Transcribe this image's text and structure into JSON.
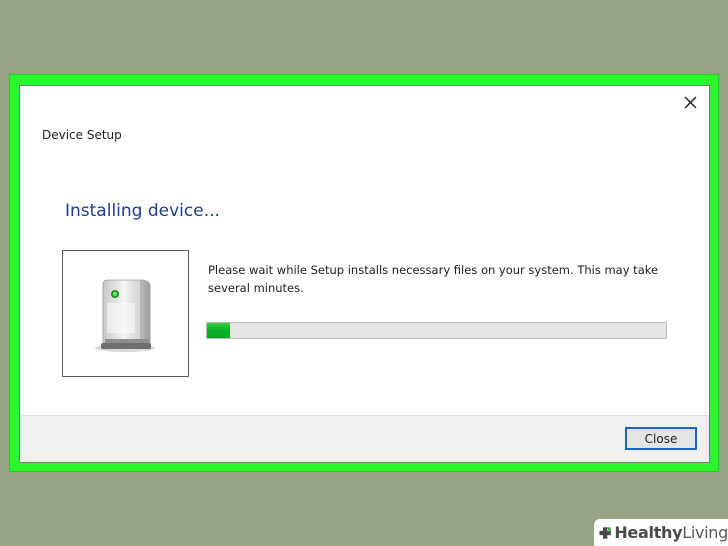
{
  "dialog": {
    "title": "Device Setup",
    "heading": "Installing device...",
    "message": "Please wait while Setup installs necessary files on your system. This may take several minutes.",
    "progress_fraction": 0.05,
    "close_button_label": "Close",
    "close_icon": "close-icon",
    "device_icon": "device-tower-icon"
  },
  "colors": {
    "highlight_frame": "#2bf52b",
    "heading": "#1a3d8f",
    "progress_fill": "#06b025",
    "background": "#95a584"
  },
  "watermark": {
    "word_bold": "Healthy",
    "word_light": "Living",
    "icon": "plus-leaf-icon"
  }
}
